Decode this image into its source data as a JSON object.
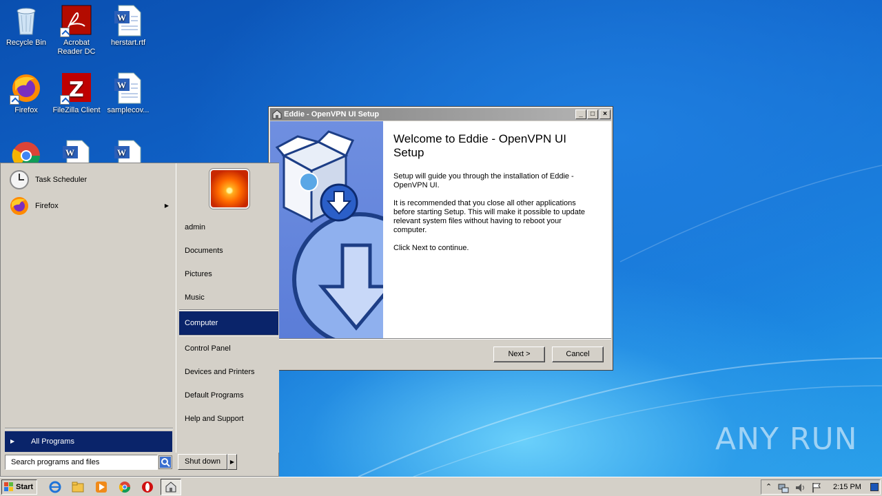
{
  "desktop": {
    "icons": [
      {
        "label": "Recycle Bin",
        "icon": "recycle-bin-icon"
      },
      {
        "label": "Acrobat Reader DC",
        "icon": "acrobat-icon"
      },
      {
        "label": "herstart.rtf",
        "icon": "word-document-icon"
      },
      {
        "label": "Firefox",
        "icon": "firefox-icon"
      },
      {
        "label": "FileZilla Client",
        "icon": "filezilla-icon"
      },
      {
        "label": "samplecov...",
        "icon": "word-document-icon"
      }
    ],
    "watermark": "ANY RUN"
  },
  "installer": {
    "title": "Eddie - OpenVPN UI Setup",
    "heading": "Welcome to Eddie - OpenVPN UI Setup",
    "para1": "Setup will guide you through the installation of Eddie - OpenVPN UI.",
    "para2": "It is recommended that you close all other applications before starting Setup. This will make it possible to update relevant system files without having to reboot your computer.",
    "para3": "Click Next to continue.",
    "next_label": "Next >",
    "cancel_label": "Cancel",
    "minimize": "_",
    "maximize": "□",
    "close": "×"
  },
  "start_menu": {
    "programs": [
      {
        "label": "Task Scheduler",
        "icon": "clock-icon"
      },
      {
        "label": "Firefox",
        "icon": "firefox-icon"
      }
    ],
    "all_programs": "All Programs",
    "search_placeholder": "Search programs and files",
    "shutdown": "Shut down",
    "links": [
      "admin",
      "Documents",
      "Pictures",
      "Music",
      "Computer",
      "Control Panel",
      "Devices and Printers",
      "Default Programs",
      "Help and Support"
    ],
    "active_link": "Computer"
  },
  "taskbar": {
    "start_label": "Start",
    "clock": "2:15 PM"
  }
}
